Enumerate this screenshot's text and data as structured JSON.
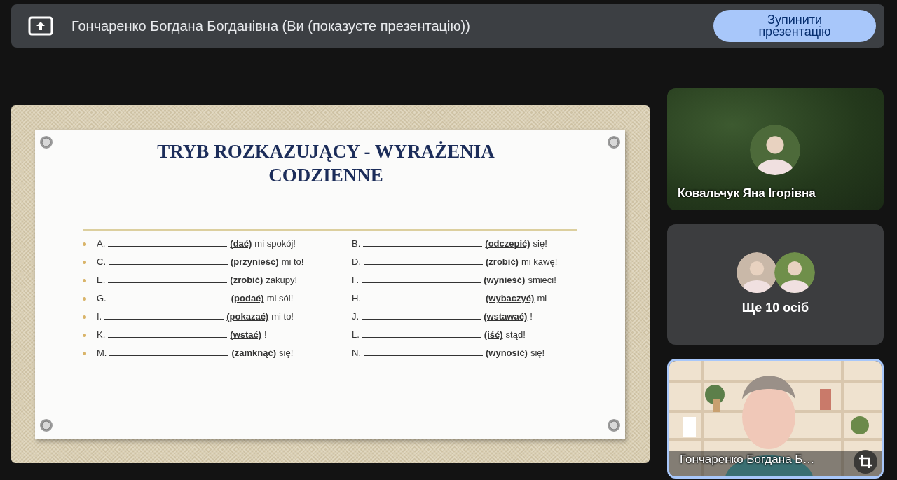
{
  "presenting_bar": {
    "title": "Гончаренко Богдана Богданівна (Ви (показуєте презентацію))",
    "stop_button": "Зупинити презентацію"
  },
  "slide": {
    "title": "TRYB ROZKAZUJĄCY - WYRAŻENIA CODZIENNE",
    "exercises": [
      {
        "letter": "A.",
        "verb": "(dać)",
        "rest": "mi spokój!"
      },
      {
        "letter": "B.",
        "verb": "(odczepić)",
        "rest": "się!"
      },
      {
        "letter": "C.",
        "verb": "(przynieść)",
        "rest": "mi to!"
      },
      {
        "letter": "D.",
        "verb": "(zrobić)",
        "rest": "mi kawę!"
      },
      {
        "letter": "E.",
        "verb": "(zrobić)",
        "rest": "zakupy!"
      },
      {
        "letter": "F.",
        "verb": "(wynieść)",
        "rest": "śmieci!"
      },
      {
        "letter": "G.",
        "verb": "(podać)",
        "rest": "mi sól!"
      },
      {
        "letter": "H.",
        "verb": "(wybaczyć)",
        "rest": "mi"
      },
      {
        "letter": "I.",
        "verb": "(pokazać)",
        "rest": "mi to!"
      },
      {
        "letter": "J.",
        "verb": "(wstawać)",
        "rest": "!"
      },
      {
        "letter": "K.",
        "verb": "(wstać)",
        "rest": "!"
      },
      {
        "letter": "L.",
        "verb": "(iść)",
        "rest": "stąd!"
      },
      {
        "letter": "M.",
        "verb": "(zamknąć)",
        "rest": "się!"
      },
      {
        "letter": "N.",
        "verb": "(wynosić)",
        "rest": "się!"
      }
    ]
  },
  "tiles": [
    {
      "kind": "avatar",
      "name": "Ковальчук Яна Ігорівна"
    },
    {
      "kind": "group",
      "label": "Ще 10 осіб"
    },
    {
      "kind": "video",
      "name": "Гончаренко Богдана Б…",
      "selected": true
    }
  ]
}
